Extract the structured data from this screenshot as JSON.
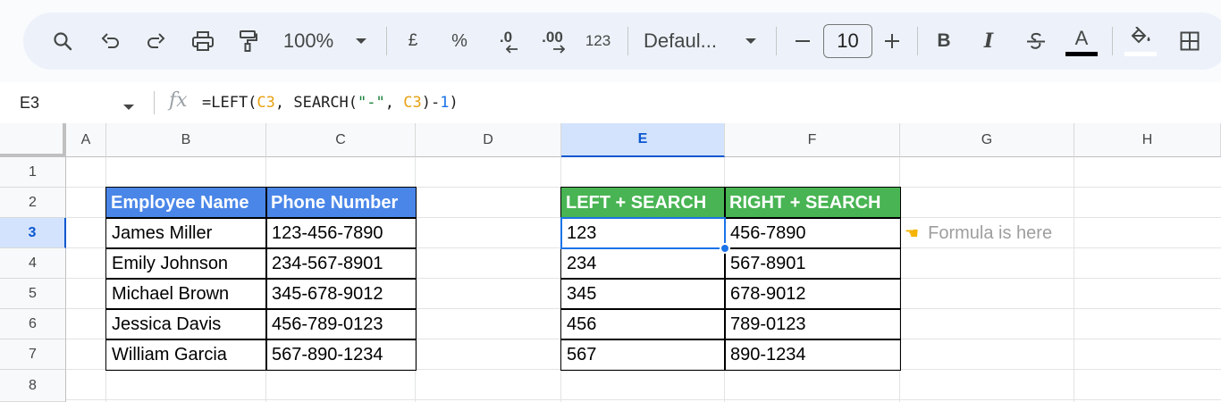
{
  "toolbar": {
    "zoom": "100%",
    "currency_symbol": "£",
    "percent_symbol": "%",
    "decrease_decimal_label": ".0",
    "increase_decimal_label": ".00",
    "number_format_label": "123",
    "font_name": "Defaul...",
    "font_size": "10",
    "bold_label": "B",
    "italic_label": "I",
    "text_color_label": "A",
    "text_color": "#000000"
  },
  "formula_bar": {
    "name_box": "E3",
    "fx_label": "fx",
    "formula_parts": {
      "p1": "=LEFT(",
      "ref1": "C3",
      "p2": ", SEARCH(",
      "str1": "\"-\"",
      "p3": ", ",
      "ref2": "C3",
      "p4": ")-",
      "num1": "1",
      "p5": ")"
    }
  },
  "sheet": {
    "columns": [
      "A",
      "B",
      "C",
      "D",
      "E",
      "F",
      "G",
      "H"
    ],
    "selected_column": "E",
    "rows": [
      "1",
      "2",
      "3",
      "4",
      "5",
      "6",
      "7",
      "8"
    ],
    "selected_row": "3",
    "table1": {
      "headers": [
        "Employee Name",
        "Phone Number"
      ],
      "rows": [
        [
          "James Miller",
          "123-456-7890"
        ],
        [
          "Emily Johnson",
          "234-567-8901"
        ],
        [
          "Michael Brown",
          "345-678-9012"
        ],
        [
          "Jessica Davis",
          "456-789-0123"
        ],
        [
          "William Garcia",
          "567-890-1234"
        ]
      ],
      "header_color": "#4a86e8"
    },
    "table2": {
      "headers": [
        "LEFT + SEARCH",
        "RIGHT + SEARCH"
      ],
      "rows": [
        [
          "123",
          "456-7890"
        ],
        [
          "234",
          "567-8901"
        ],
        [
          "345",
          "678-9012"
        ],
        [
          "456",
          "789-0123"
        ],
        [
          "567",
          "890-1234"
        ]
      ],
      "header_color": "#48b453"
    },
    "note": "Formula is here",
    "selection_color": "#1a73e8"
  }
}
